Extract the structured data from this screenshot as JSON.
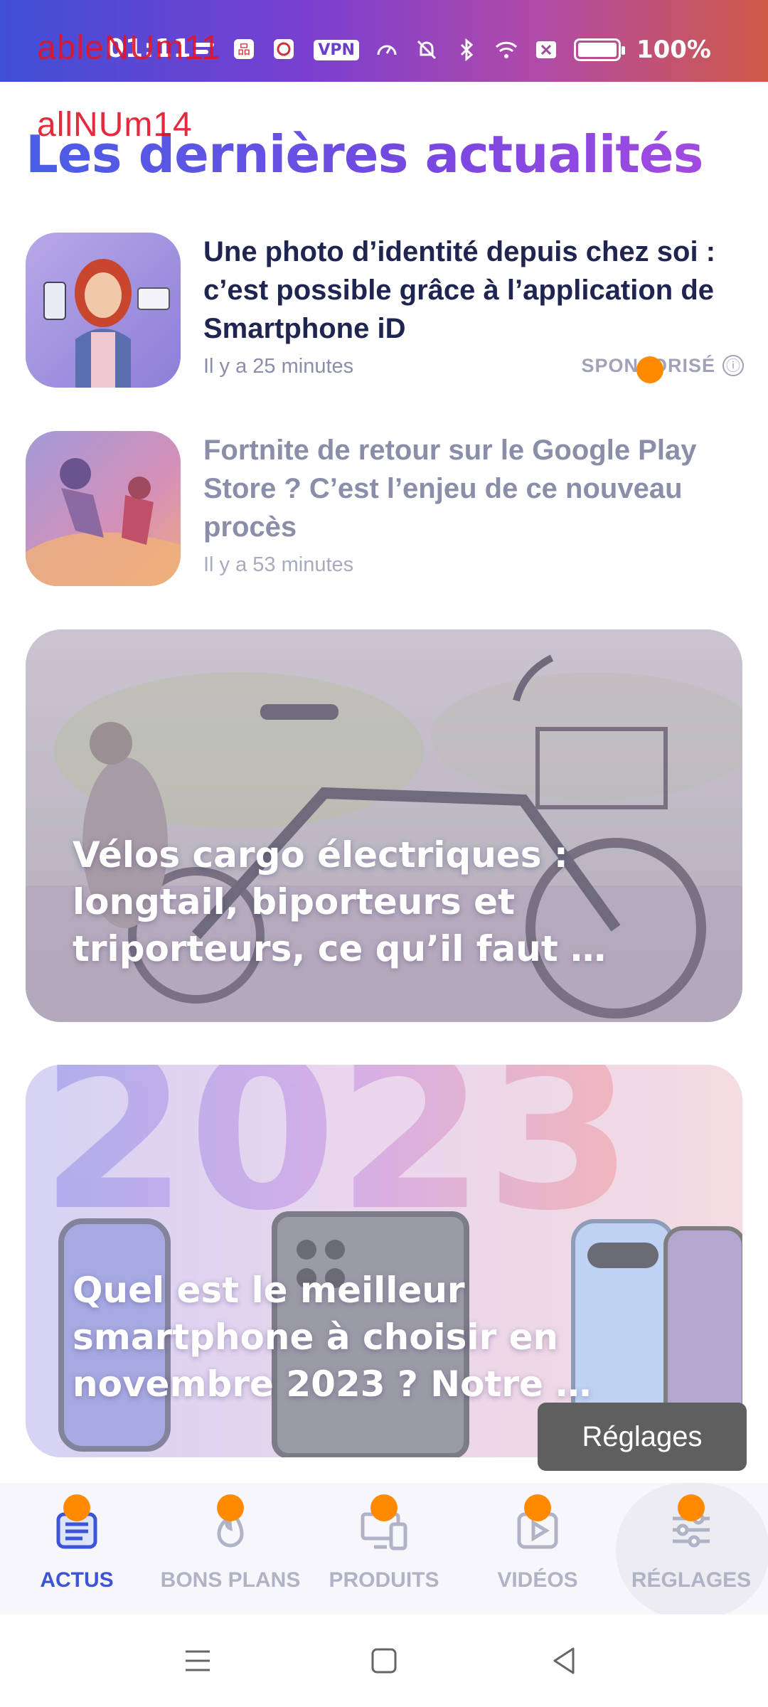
{
  "status_bar": {
    "time": "01:11",
    "vpn_label": "VPN",
    "battery_percent": 100,
    "battery_text": "100%",
    "overlay_text_1": "ableNUm11",
    "overlay_text_2": "allNUm14",
    "icons": [
      "notification-icon",
      "app-icon",
      "app-icon-2",
      "dot-icon",
      "speed-icon",
      "mute-icon",
      "bluetooth-icon",
      "wifi-icon",
      "close-box-icon"
    ]
  },
  "page": {
    "section_title": "Les dernières actualités"
  },
  "articles_small": [
    {
      "title": "Une photo d’identité depuis chez soi : c’est possible grâce à l’application de Smartphone iD",
      "time": "Il y a 25 minutes",
      "badge": "SPONSORISÉ",
      "info_icon": "ⓘ"
    },
    {
      "title": "Fortnite de retour sur le Google Play Store ? C’est l’enjeu de ce nouveau procès",
      "time": "Il y a 53 minutes"
    }
  ],
  "articles_big": [
    {
      "title": "Vélos cargo électriques : longtail, biporteurs et triporteurs, ce qu’il faut …"
    },
    {
      "title": "Quel est le meilleur smartphone à choisir en novembre 2023 ? Notre …"
    }
  ],
  "toast": {
    "text": "Réglages"
  },
  "bottom_nav": [
    {
      "label": "ACTUS",
      "icon": "news-icon",
      "active": true
    },
    {
      "label": "BONS PLANS",
      "icon": "flame-icon",
      "active": false
    },
    {
      "label": "PRODUITS",
      "icon": "devices-icon",
      "active": false
    },
    {
      "label": "VIDÉOS",
      "icon": "play-icon",
      "active": false
    },
    {
      "label": "RÉGLAGES",
      "icon": "sliders-icon",
      "active": false
    }
  ],
  "colors": {
    "accent": "#3b55d6",
    "title_gradient_start": "#4a5ee6",
    "title_gradient_end": "#a24ae0",
    "marker": "#ff8a00"
  }
}
